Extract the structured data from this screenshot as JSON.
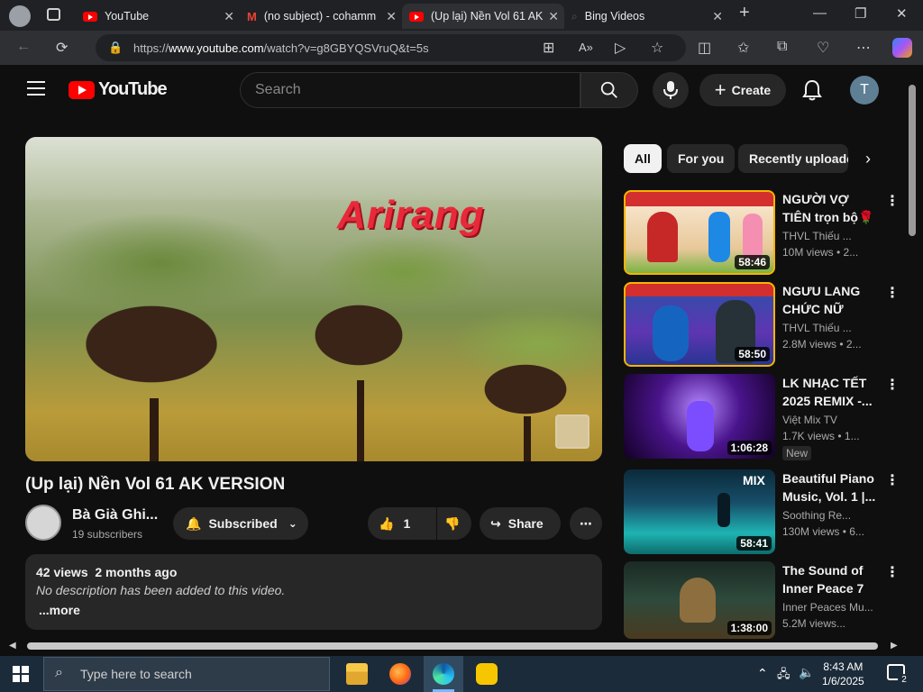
{
  "browser": {
    "tabs": [
      {
        "title": "YouTube",
        "favicon": "youtube-icon"
      },
      {
        "title": "(no subject) - cohamm",
        "favicon": "gmail-icon"
      },
      {
        "title": "(Up lại) Nền Vol 61 AK",
        "favicon": "youtube-icon"
      },
      {
        "title": "Bing Videos",
        "favicon": "bing-icon"
      }
    ],
    "url_prefix": "https://",
    "url_host": "www.youtube.com",
    "url_rest": "/watch?v=g8GBYQSVruQ&t=5s"
  },
  "youtube": {
    "logo_text": "YouTube",
    "search_placeholder": "Search",
    "create_label": "Create",
    "avatar_initial": "T",
    "video": {
      "overlay_text": "Arirang",
      "title": "(Up lại) Nền Vol 61 AK VERSION",
      "channel": "Bà Già Ghi...",
      "subscribers": "19 subscribers",
      "subscribed_label": "Subscribed",
      "likes": "1",
      "share_label": "Share",
      "views_date": "42 views  2 months ago",
      "description": "No description has been added to this video.",
      "more_label": "...more"
    },
    "chips": [
      "All",
      "For you",
      "Recently uploade"
    ],
    "recommendations": [
      {
        "title": "NGƯỜI VỢ TIÊN trọn bộ🌹🌷C...",
        "channel": "THVL Thiếu ...",
        "views": "10M views  • 2...",
        "duration": "58:46",
        "badge": ""
      },
      {
        "title": "NGƯU LANG CHỨC NỮ Trọ...",
        "channel": "THVL Thiếu ...",
        "views": "2.8M views  • 2...",
        "duration": "58:50",
        "badge": ""
      },
      {
        "title": "LK NHẠC TẾT 2025 REMIX -...",
        "channel": "Việt Mix TV",
        "views": "1.7K views  • 1...",
        "duration": "1:06:28",
        "badge": "New"
      },
      {
        "title": "Beautiful Piano Music, Vol. 1 |...",
        "channel": "Soothing Re...",
        "views": "130M views  • 6...",
        "duration": "58:41",
        "badge": ""
      },
      {
        "title": "The Sound of Inner Peace 7 ...",
        "channel": "Inner Peaces Mu...",
        "views": "5.2M views...",
        "duration": "1:38:00",
        "badge": ""
      }
    ]
  },
  "taskbar": {
    "search_placeholder": "Type here to search",
    "time": "8:43 AM",
    "date": "1/6/2025",
    "notifications": "2"
  },
  "colors": {
    "youtube_red": "#ff0000",
    "background": "#0f0f0f",
    "surface": "#272727"
  }
}
